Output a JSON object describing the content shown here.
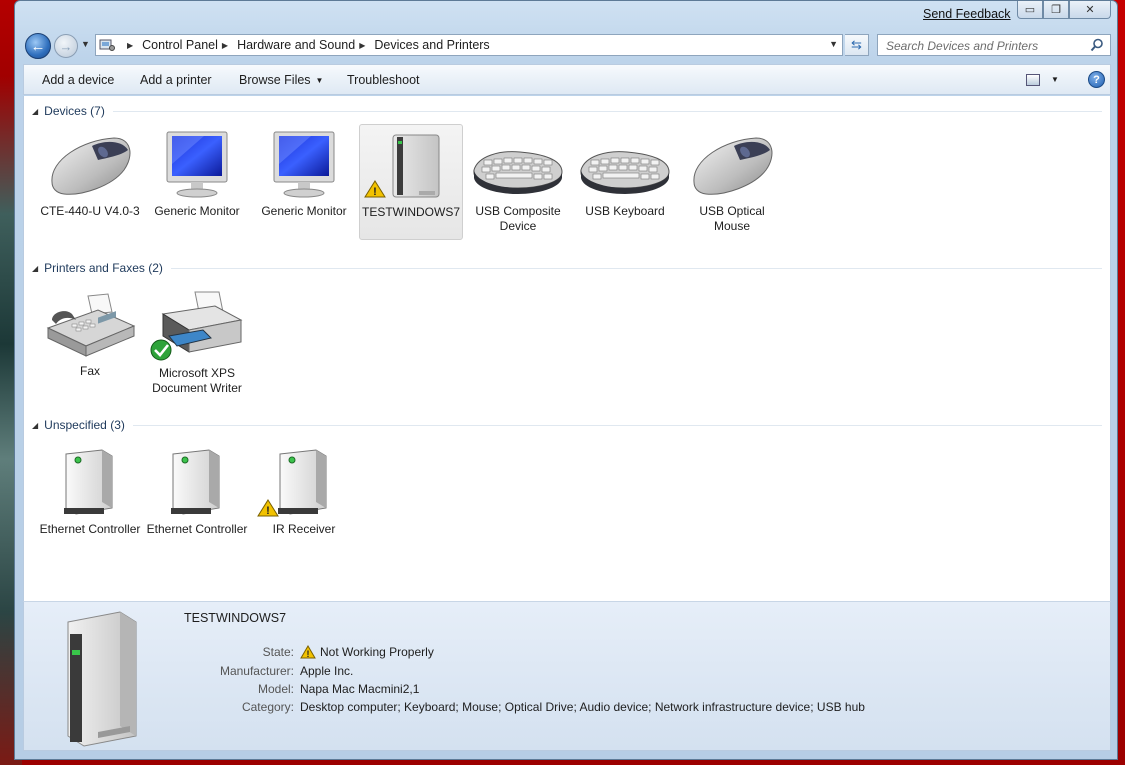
{
  "window": {
    "send_feedback": "Send Feedback",
    "caption": {
      "minimize": "▭",
      "restore": "❐",
      "close": "✕"
    }
  },
  "nav": {
    "breadcrumbs": [
      "Control Panel",
      "Hardware and Sound",
      "Devices and Printers"
    ],
    "search_placeholder": "Search Devices and Printers"
  },
  "toolbar": {
    "add_device": "Add a device",
    "add_printer": "Add a printer",
    "browse_files": "Browse Files",
    "troubleshoot": "Troubleshoot",
    "help": "?"
  },
  "groups": {
    "devices": {
      "title": "Devices (7)",
      "items": [
        {
          "label": "CTE-440-U V4.0-3",
          "icon": "mouse-icon"
        },
        {
          "label": "Generic Monitor",
          "icon": "monitor-icon"
        },
        {
          "label": "Generic Monitor",
          "icon": "monitor-icon"
        },
        {
          "label": "TESTWINDOWS7",
          "icon": "computer-icon",
          "warning": true,
          "selected": true
        },
        {
          "label": "USB Composite Device",
          "icon": "keyboard-icon"
        },
        {
          "label": "USB Keyboard",
          "icon": "keyboard-icon"
        },
        {
          "label": "USB Optical Mouse",
          "icon": "mouse-icon"
        }
      ]
    },
    "printers": {
      "title": "Printers and Faxes (2)",
      "items": [
        {
          "label": "Fax",
          "icon": "fax-icon"
        },
        {
          "label": "Microsoft XPS Document Writer",
          "icon": "printer-icon",
          "default": true
        }
      ]
    },
    "unspecified": {
      "title": "Unspecified (3)",
      "items": [
        {
          "label": "Ethernet Controller",
          "icon": "device-box-icon"
        },
        {
          "label": "Ethernet Controller",
          "icon": "device-box-icon"
        },
        {
          "label": "IR Receiver",
          "icon": "device-box-icon",
          "warning": true
        }
      ]
    }
  },
  "details": {
    "name": "TESTWINDOWS7",
    "state_label": "State:",
    "state": "Not Working Properly",
    "manufacturer_label": "Manufacturer:",
    "manufacturer": "Apple Inc.",
    "model_label": "Model:",
    "model": "Napa Mac Macmini2,1",
    "category_label": "Category:",
    "category": "Desktop computer; Keyboard; Mouse; Optical Drive; Audio device; Network infrastructure device; USB hub"
  },
  "colors": {
    "accent": "#1e395b",
    "window_frame": "#bcd3ea",
    "desktop": "#c00000"
  }
}
